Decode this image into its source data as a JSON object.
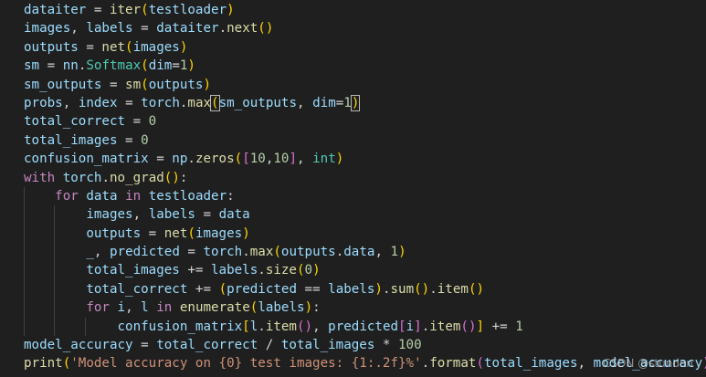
{
  "theme": {
    "background": "#1f1f1f",
    "colors": {
      "var": "#9cdcfe",
      "op": "#d4d4d4",
      "func": "#dcdcaa",
      "cls": "#4ec9b0",
      "kw": "#c586c0",
      "builtin": "#dcdcaa",
      "num": "#b5cea8",
      "str": "#ce9178",
      "punc": "#d4d4d4",
      "b1": "#ffd700",
      "b2": "#da70d6",
      "b3": "#179fff"
    }
  },
  "code": {
    "lines": [
      {
        "indent": 0,
        "tokens": [
          [
            "dataiter",
            "var"
          ],
          [
            " = ",
            "op"
          ],
          [
            "iter",
            "builtin"
          ],
          [
            "(",
            "b1"
          ],
          [
            "testloader",
            "var"
          ],
          [
            ")",
            "b1"
          ]
        ]
      },
      {
        "indent": 0,
        "tokens": [
          [
            "images",
            "var"
          ],
          [
            ", ",
            "op"
          ],
          [
            "labels",
            "var"
          ],
          [
            " = ",
            "op"
          ],
          [
            "dataiter",
            "var"
          ],
          [
            ".",
            "op"
          ],
          [
            "next",
            "func"
          ],
          [
            "(",
            "b1"
          ],
          [
            ")",
            "b1"
          ]
        ]
      },
      {
        "indent": 0,
        "tokens": [
          [
            "outputs",
            "var"
          ],
          [
            " = ",
            "op"
          ],
          [
            "net",
            "func"
          ],
          [
            "(",
            "b1"
          ],
          [
            "images",
            "var"
          ],
          [
            ")",
            "b1"
          ]
        ]
      },
      {
        "indent": 0,
        "tokens": [
          [
            "sm",
            "var"
          ],
          [
            " = ",
            "op"
          ],
          [
            "nn",
            "var"
          ],
          [
            ".",
            "op"
          ],
          [
            "Softmax",
            "cls"
          ],
          [
            "(",
            "b1"
          ],
          [
            "dim",
            "var"
          ],
          [
            "=",
            "op"
          ],
          [
            "1",
            "num"
          ],
          [
            ")",
            "b1"
          ]
        ]
      },
      {
        "indent": 0,
        "tokens": [
          [
            "sm_outputs",
            "var"
          ],
          [
            " = ",
            "op"
          ],
          [
            "sm",
            "func"
          ],
          [
            "(",
            "b1"
          ],
          [
            "outputs",
            "var"
          ],
          [
            ")",
            "b1"
          ]
        ]
      },
      {
        "indent": 0,
        "tokens": [
          [
            "probs",
            "var"
          ],
          [
            ", ",
            "op"
          ],
          [
            "index",
            "var"
          ],
          [
            " = ",
            "op"
          ],
          [
            "torch",
            "var"
          ],
          [
            ".",
            "op"
          ],
          [
            "max",
            "func"
          ],
          [
            "(",
            "b1box"
          ],
          [
            "sm_outputs",
            "var"
          ],
          [
            ", ",
            "op"
          ],
          [
            "dim",
            "var"
          ],
          [
            "=",
            "op"
          ],
          [
            "1",
            "num"
          ],
          [
            ")",
            "b1box"
          ]
        ]
      },
      {
        "indent": 0,
        "tokens": [
          [
            "total_correct",
            "var"
          ],
          [
            " = ",
            "op"
          ],
          [
            "0",
            "num"
          ]
        ]
      },
      {
        "indent": 0,
        "tokens": [
          [
            "total_images",
            "var"
          ],
          [
            " = ",
            "op"
          ],
          [
            "0",
            "num"
          ]
        ]
      },
      {
        "indent": 0,
        "tokens": [
          [
            "confusion_matrix",
            "var"
          ],
          [
            " = ",
            "op"
          ],
          [
            "np",
            "var"
          ],
          [
            ".",
            "op"
          ],
          [
            "zeros",
            "func"
          ],
          [
            "(",
            "b1"
          ],
          [
            "[",
            "b2"
          ],
          [
            "10",
            "num"
          ],
          [
            ",",
            "op"
          ],
          [
            "10",
            "num"
          ],
          [
            "]",
            "b2"
          ],
          [
            ", ",
            "op"
          ],
          [
            "int",
            "cls"
          ],
          [
            ")",
            "b1"
          ]
        ]
      },
      {
        "indent": 0,
        "tokens": [
          [
            "with",
            "kw"
          ],
          [
            " ",
            "op"
          ],
          [
            "torch",
            "var"
          ],
          [
            ".",
            "op"
          ],
          [
            "no_grad",
            "func"
          ],
          [
            "(",
            "b1"
          ],
          [
            ")",
            "b1"
          ],
          [
            ":",
            "op"
          ]
        ]
      },
      {
        "indent": 1,
        "tokens": [
          [
            "for",
            "kw"
          ],
          [
            " ",
            "op"
          ],
          [
            "data",
            "var"
          ],
          [
            " ",
            "op"
          ],
          [
            "in",
            "kw"
          ],
          [
            " ",
            "op"
          ],
          [
            "testloader",
            "var"
          ],
          [
            ":",
            "op"
          ]
        ]
      },
      {
        "indent": 2,
        "tokens": [
          [
            "images",
            "var"
          ],
          [
            ", ",
            "op"
          ],
          [
            "labels",
            "var"
          ],
          [
            " = ",
            "op"
          ],
          [
            "data",
            "var"
          ]
        ]
      },
      {
        "indent": 2,
        "tokens": [
          [
            "outputs",
            "var"
          ],
          [
            " = ",
            "op"
          ],
          [
            "net",
            "func"
          ],
          [
            "(",
            "b1"
          ],
          [
            "images",
            "var"
          ],
          [
            ")",
            "b1"
          ]
        ]
      },
      {
        "indent": 2,
        "tokens": [
          [
            "_",
            "var"
          ],
          [
            ", ",
            "op"
          ],
          [
            "predicted",
            "var"
          ],
          [
            " = ",
            "op"
          ],
          [
            "torch",
            "var"
          ],
          [
            ".",
            "op"
          ],
          [
            "max",
            "func"
          ],
          [
            "(",
            "b1"
          ],
          [
            "outputs",
            "var"
          ],
          [
            ".",
            "op"
          ],
          [
            "data",
            "var"
          ],
          [
            ", ",
            "op"
          ],
          [
            "1",
            "num"
          ],
          [
            ")",
            "b1"
          ]
        ]
      },
      {
        "indent": 2,
        "tokens": [
          [
            "total_images",
            "var"
          ],
          [
            " += ",
            "op"
          ],
          [
            "labels",
            "var"
          ],
          [
            ".",
            "op"
          ],
          [
            "size",
            "func"
          ],
          [
            "(",
            "b1"
          ],
          [
            "0",
            "num"
          ],
          [
            ")",
            "b1"
          ]
        ]
      },
      {
        "indent": 2,
        "tokens": [
          [
            "total_correct",
            "var"
          ],
          [
            " += ",
            "op"
          ],
          [
            "(",
            "b1"
          ],
          [
            "predicted",
            "var"
          ],
          [
            " == ",
            "op"
          ],
          [
            "labels",
            "var"
          ],
          [
            ")",
            "b1"
          ],
          [
            ".",
            "op"
          ],
          [
            "sum",
            "func"
          ],
          [
            "(",
            "b1"
          ],
          [
            ")",
            "b1"
          ],
          [
            ".",
            "op"
          ],
          [
            "item",
            "func"
          ],
          [
            "(",
            "b1"
          ],
          [
            ")",
            "b1"
          ]
        ]
      },
      {
        "indent": 2,
        "tokens": [
          [
            "for",
            "kw"
          ],
          [
            " ",
            "op"
          ],
          [
            "i",
            "var"
          ],
          [
            ", ",
            "op"
          ],
          [
            "l",
            "var"
          ],
          [
            " ",
            "op"
          ],
          [
            "in",
            "kw"
          ],
          [
            " ",
            "op"
          ],
          [
            "enumerate",
            "builtin"
          ],
          [
            "(",
            "b1"
          ],
          [
            "labels",
            "var"
          ],
          [
            ")",
            "b1"
          ],
          [
            ":",
            "op"
          ]
        ]
      },
      {
        "indent": 3,
        "tokens": [
          [
            "confusion_matrix",
            "var"
          ],
          [
            "[",
            "b1"
          ],
          [
            "l",
            "var"
          ],
          [
            ".",
            "op"
          ],
          [
            "item",
            "func"
          ],
          [
            "(",
            "b2"
          ],
          [
            ")",
            "b2"
          ],
          [
            ", ",
            "op"
          ],
          [
            "predicted",
            "var"
          ],
          [
            "[",
            "b2"
          ],
          [
            "i",
            "var"
          ],
          [
            "]",
            "b2"
          ],
          [
            ".",
            "op"
          ],
          [
            "item",
            "func"
          ],
          [
            "(",
            "b2"
          ],
          [
            ")",
            "b2"
          ],
          [
            "]",
            "b1"
          ],
          [
            " += ",
            "op"
          ],
          [
            "1",
            "num"
          ]
        ]
      },
      {
        "indent": 0,
        "tokens": [
          [
            "model_accuracy",
            "var"
          ],
          [
            " = ",
            "op"
          ],
          [
            "total_correct",
            "var"
          ],
          [
            " / ",
            "op"
          ],
          [
            "total_images",
            "var"
          ],
          [
            " * ",
            "op"
          ],
          [
            "100",
            "num"
          ]
        ]
      },
      {
        "indent": 0,
        "tokens": [
          [
            "print",
            "builtin"
          ],
          [
            "(",
            "b1"
          ],
          [
            "'Model accuracy on {0} test images: {1:.2f}%'",
            "str"
          ],
          [
            ".",
            "op"
          ],
          [
            "format",
            "func"
          ],
          [
            "(",
            "b2"
          ],
          [
            "total_images",
            "var"
          ],
          [
            ", ",
            "op"
          ],
          [
            "model_accuracy",
            "var"
          ],
          [
            ")",
            "b2"
          ],
          [
            ")",
            "b1"
          ]
        ]
      }
    ]
  },
  "watermark": "CSDN @stunden"
}
